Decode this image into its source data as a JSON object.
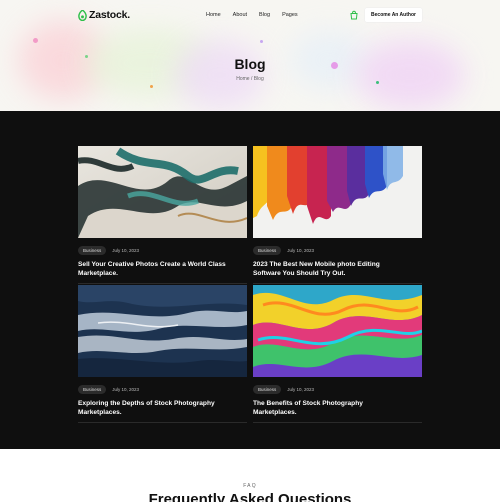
{
  "brand": {
    "name": "Zastock.",
    "accent": "#2fbf4a"
  },
  "nav": {
    "items": [
      {
        "label": "Home"
      },
      {
        "label": "About"
      },
      {
        "label": "Blog"
      },
      {
        "label": "Pages"
      }
    ],
    "cart_icon": "shopping-bag-icon",
    "cta_label": "Become An Author"
  },
  "hero": {
    "title": "Blog",
    "breadcrumb": "Home / Blog"
  },
  "blog": {
    "posts": [
      {
        "category": "Business",
        "date": "July 10, 2023",
        "title": "Sell Your Creative Photos Create a World Class Marketplace.",
        "image": "marble-teal-abstract"
      },
      {
        "category": "Business",
        "date": "July 10, 2023",
        "title": "2023 The Best New Mobile photo Editing Software You Should Try Out.",
        "image": "rainbow-paint-drips"
      },
      {
        "category": "Business",
        "date": "July 10, 2023",
        "title": "Exploring the Depths of Stock Photography Marketplaces.",
        "image": "blue-ocean-waves"
      },
      {
        "category": "Business",
        "date": "July 10, 2023",
        "title": "The Benefits of Stock Photography Marketplaces.",
        "image": "psychedelic-swirl"
      }
    ]
  },
  "faq": {
    "label": "FAQ",
    "title": "Frequently Asked Questions"
  },
  "colors": {
    "hero_bg": "#f7f6f2",
    "blog_bg": "#0f0f0f",
    "text_dark": "#111111"
  }
}
